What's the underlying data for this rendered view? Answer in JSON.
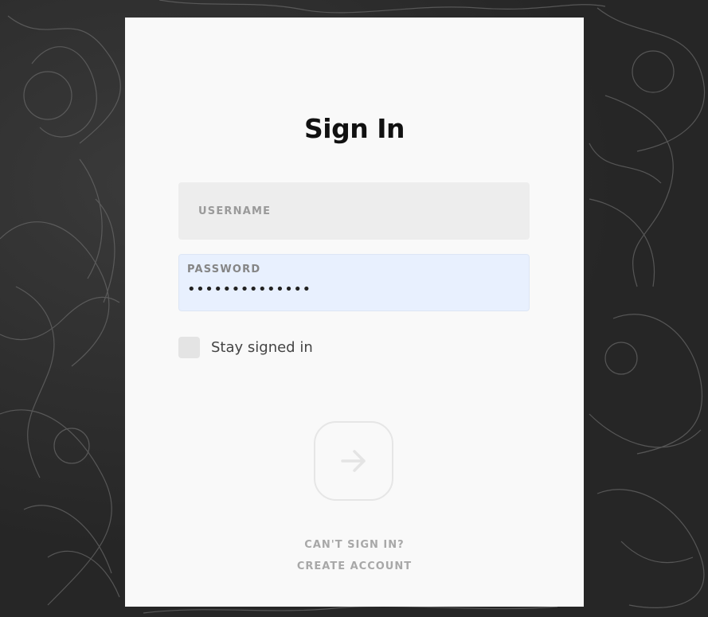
{
  "signin": {
    "title": "Sign In",
    "username": {
      "label": "USERNAME",
      "value": ""
    },
    "password": {
      "label": "PASSWORD",
      "masked_value": "••••••••••••••"
    },
    "stay_signed_in": {
      "label": "Stay signed in",
      "checked": false
    },
    "submit_icon": "arrow-right-icon",
    "links": {
      "cant_sign_in": "CAN'T SIGN IN?",
      "create_account": "CREATE ACCOUNT"
    }
  },
  "colors": {
    "card_background": "#f9f9f9",
    "password_field_background": "#e8f0fe",
    "username_field_background": "#ededed",
    "background": "#2a2a2a"
  }
}
